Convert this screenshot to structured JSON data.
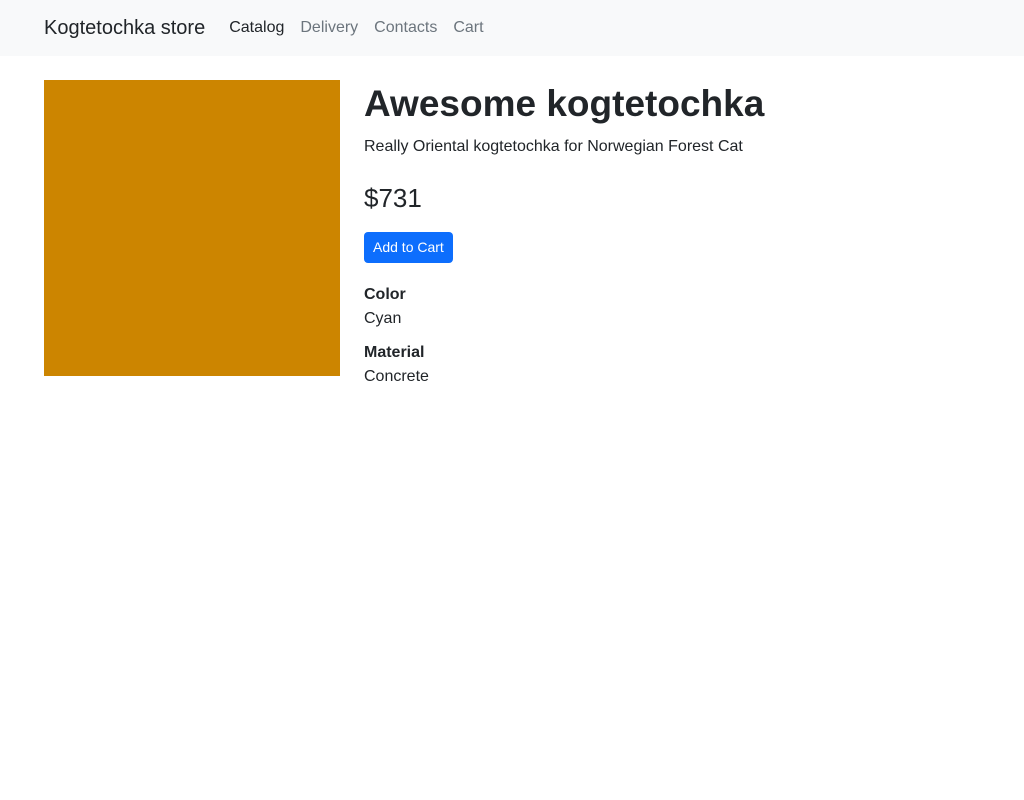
{
  "navbar": {
    "brand": "Kogtetochka store",
    "links": [
      {
        "label": "Catalog",
        "active": true
      },
      {
        "label": "Delivery",
        "active": false
      },
      {
        "label": "Contacts",
        "active": false
      },
      {
        "label": "Cart",
        "active": false
      }
    ]
  },
  "product": {
    "image_color": "#cc8500",
    "title": "Awesome kogtetochka",
    "description": "Really Oriental kogtetochka for Norwegian Forest Cat",
    "price": "$731",
    "add_to_cart_label": "Add to Cart",
    "attributes": [
      {
        "label": "Color",
        "value": "Cyan"
      },
      {
        "label": "Material",
        "value": "Concrete"
      }
    ]
  },
  "colors": {
    "primary": "#0d6efd",
    "navbar_bg": "#f8f9fa",
    "text": "#212529",
    "muted": "#6c757d"
  }
}
